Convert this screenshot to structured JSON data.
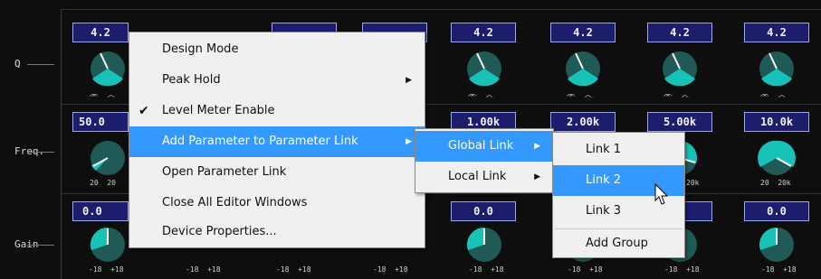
{
  "rows": {
    "q": "Q",
    "freq": "Freq.",
    "gain": "Gain"
  },
  "q_values": [
    "4.2",
    "4.2",
    "4.2",
    "4.2",
    "4.2"
  ],
  "freq_values": [
    "50.0",
    "1.00k",
    "2.00k",
    "5.00k",
    "10.0k"
  ],
  "gain_values": [
    "0.0",
    "0.0",
    "0.0",
    "0.0",
    "0.0"
  ],
  "scale_labels": {
    "q": "ᨏ  ︿",
    "freq_first": "20  20",
    "freq_last": "20  20k",
    "freq_mid": "20k",
    "gain": "-18  +18"
  },
  "context_menu": {
    "items": [
      {
        "label": "Design Mode"
      },
      {
        "label": "Peak Hold",
        "submenu": true
      },
      {
        "label": "Level Meter Enable",
        "checked": true
      },
      {
        "label": "Add Parameter to Parameter Link",
        "submenu": true,
        "highlighted": true
      },
      {
        "label": "Open Parameter Link"
      },
      {
        "label": "Close All Editor Windows"
      },
      {
        "label": "Device Properties..."
      }
    ]
  },
  "link_submenu": {
    "items": [
      {
        "label": "Global Link",
        "submenu": true,
        "highlighted": true
      },
      {
        "label": "Local Link",
        "submenu": true
      }
    ]
  },
  "global_link_submenu": {
    "items": [
      {
        "label": "Link 1"
      },
      {
        "label": "Link 2",
        "highlighted": true
      },
      {
        "label": "Link 3"
      },
      {
        "label": "Add Group"
      }
    ]
  },
  "glyphs": {
    "check": "✔",
    "submenu_arrow": "▶"
  },
  "colors": {
    "knob_teal": "#17c3b8",
    "knob_dark": "#1f5a56",
    "value_bg": "#1d1d6e",
    "highlight": "#3399ff"
  }
}
